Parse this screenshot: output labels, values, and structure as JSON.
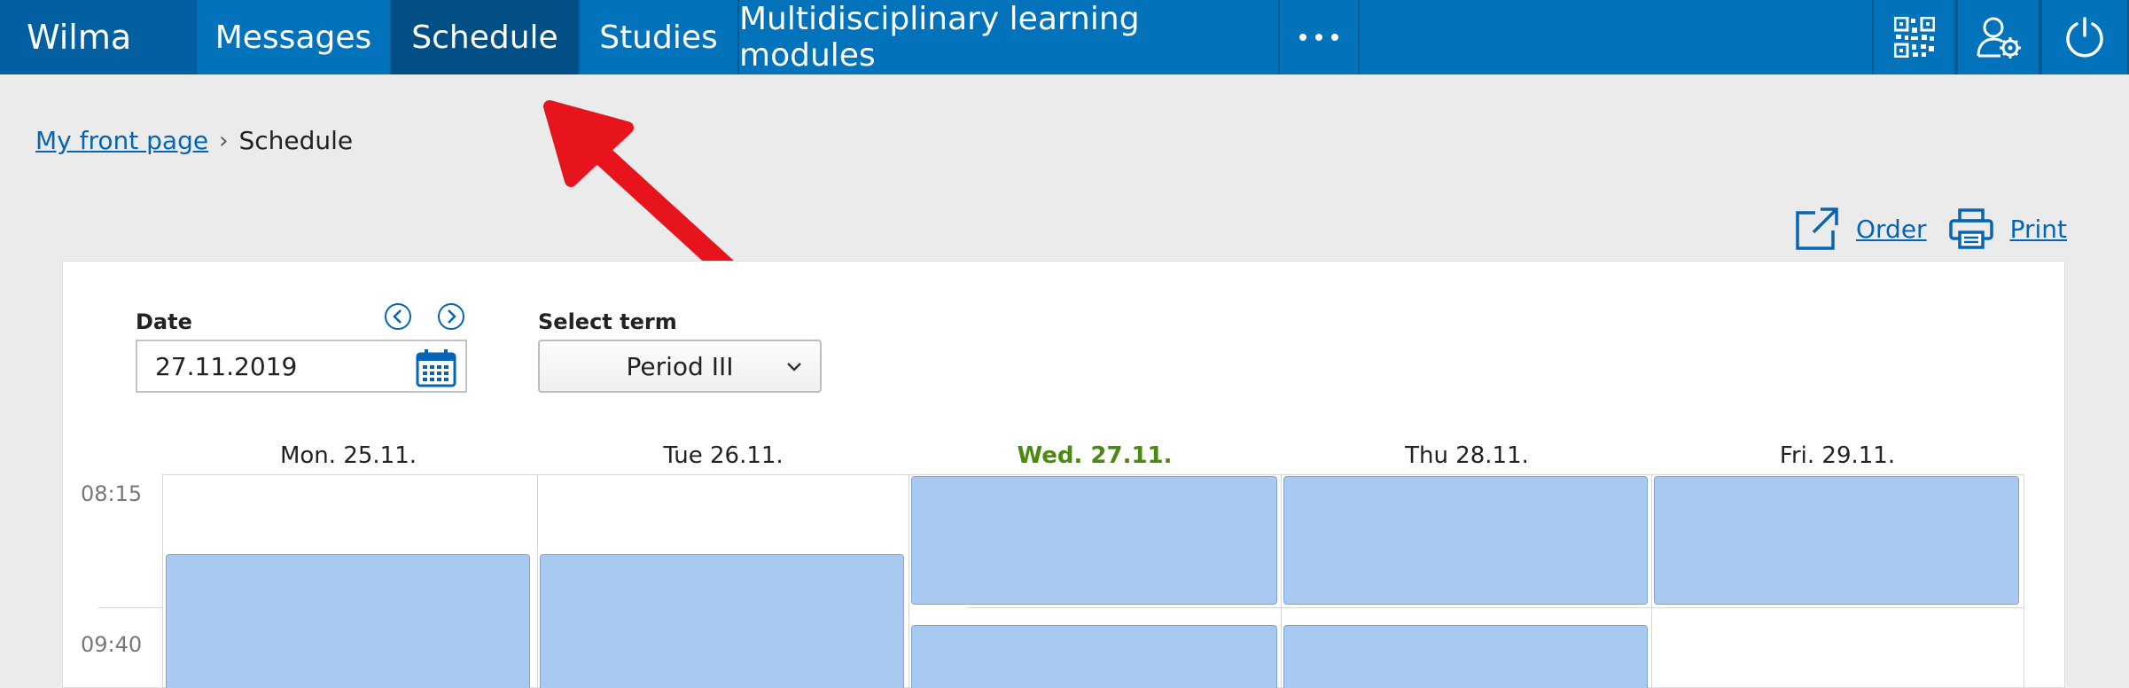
{
  "nav": {
    "brand": "Wilma",
    "items": [
      {
        "label": "Messages"
      },
      {
        "label": "Schedule"
      },
      {
        "label": "Studies"
      },
      {
        "label": "Multidisciplinary learning modules"
      }
    ],
    "icons": [
      "qr-code-icon",
      "user-settings-icon",
      "power-icon"
    ]
  },
  "breadcrumb": {
    "home": "My front page",
    "current": "Schedule"
  },
  "actions": {
    "order": "Order",
    "print": "Print"
  },
  "form": {
    "date_label": "Date",
    "date_value": "27.11.2019",
    "term_label": "Select term",
    "term_value": "Period III"
  },
  "schedule": {
    "days": [
      "Mon. 25.11.",
      "Tue 26.11.",
      "Wed. 27.11.",
      "Thu 28.11.",
      "Fri. 29.11."
    ],
    "today_index": 2,
    "times": [
      "08:15",
      "09:40"
    ]
  },
  "colors": {
    "nav_bg": "#0272bb",
    "nav_active": "#024f86",
    "lesson_fill": "#a8caf0",
    "today_text": "#4a8a10",
    "link": "#0565b4",
    "annotation": "#e8141d"
  }
}
